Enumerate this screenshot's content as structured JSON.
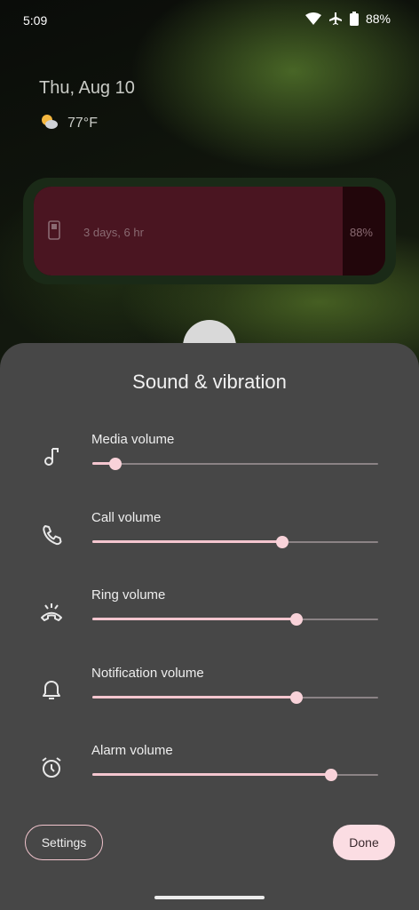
{
  "status_bar": {
    "time": "5:09",
    "battery": "88%",
    "icons": [
      "wifi-icon",
      "airplane-icon",
      "battery-icon"
    ]
  },
  "lockscreen": {
    "date": "Thu, Aug 10",
    "weather": {
      "icon": "partly-sunny-icon",
      "temp": "77°F"
    },
    "battery_widget": {
      "time_left": "3 days, 6 hr",
      "percent_label": "88%",
      "level": 0.88,
      "icon": "phone-icon"
    }
  },
  "sheet": {
    "title": "Sound & vibration",
    "volumes": [
      {
        "label": "Media volume",
        "icon": "music-note-icon",
        "level": 0.08
      },
      {
        "label": "Call volume",
        "icon": "phone-call-icon",
        "level": 0.665
      },
      {
        "label": "Ring volume",
        "icon": "ring-icon",
        "level": 0.715
      },
      {
        "label": "Notification volume",
        "icon": "bell-icon",
        "level": 0.715
      },
      {
        "label": "Alarm volume",
        "icon": "alarm-clock-icon",
        "level": 0.835
      }
    ],
    "settings_label": "Settings",
    "done_label": "Done"
  },
  "colors": {
    "sheet_bg": "#474747",
    "accent": "#f8d2d9",
    "done_bg": "#fbdde3"
  }
}
